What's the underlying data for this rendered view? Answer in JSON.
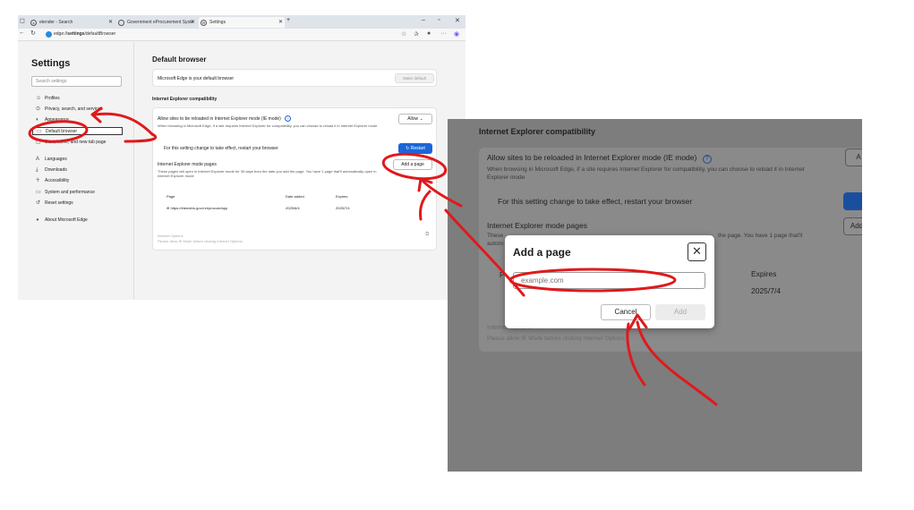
{
  "browser": {
    "tabs": [
      {
        "label": "etender - Search"
      },
      {
        "label": "Government eProcurement Syste"
      },
      {
        "label": "Settings"
      }
    ],
    "window_controls": [
      "–",
      "▫",
      "✕"
    ],
    "address": {
      "prefix": "edge://",
      "bold": "settings",
      "suffix": "/defaultBrowser"
    }
  },
  "settings": {
    "title": "Settings",
    "search_placeholder": "Search settings",
    "nav": [
      {
        "label": "Profiles",
        "icon": "profile-icon"
      },
      {
        "label": "Privacy, search, and services",
        "icon": "lock-icon"
      },
      {
        "label": "Appearance",
        "icon": "appearance-icon"
      },
      {
        "label": "Default browser",
        "icon": "browser-icon"
      },
      {
        "label": "Start, home, and new tab page",
        "icon": "home-icon"
      },
      {
        "label": "Languages",
        "icon": "language-icon"
      },
      {
        "label": "Downloads",
        "icon": "download-icon"
      },
      {
        "label": "Accessibility",
        "icon": "accessibility-icon"
      },
      {
        "label": "System and performance",
        "icon": "system-icon"
      },
      {
        "label": "Reset settings",
        "icon": "reset-icon"
      },
      {
        "label": "About Microsoft Edge",
        "icon": "edge-icon"
      }
    ],
    "selected_index": 3
  },
  "main": {
    "heading": "Default browser",
    "default_status": "Microsoft Edge is your default browser",
    "make_default_label": "Make default",
    "ie_heading": "Internet Explorer compatibility",
    "ie_mode_label": "Allow sites to be reloaded in Internet Explorer mode (IE mode)",
    "ie_mode_desc": "When browsing in Microsoft Edge, if a site requires Internet Explorer for compatibility, you can choose to reload it in Internet Explorer mode",
    "allow_label": "Allow",
    "restart_text": "For this setting change to take effect, restart your browser",
    "restart_label": "Restart",
    "pages_heading": "Internet Explorer mode pages",
    "pages_desc": "These pages will open in Internet Explorer mode for 30 days from the date you add the page. You have 1 page that'll automatically open in Internet Explorer mode",
    "add_page_label": "Add a page",
    "table": {
      "headers": [
        "Page",
        "Date added",
        "Expires"
      ],
      "rows": [
        {
          "page": "https://etenders.gov.in/eprocure/app",
          "date_added": "2025/6/4",
          "expires": "2025/7/4"
        }
      ]
    },
    "internet_options_label": "Internet Options",
    "internet_options_desc": "Please allow IE Mode before clicking Internet Options"
  },
  "zoom": {
    "heading": "Internet Explorer compatibility",
    "ie_mode_label": "Allow sites to be reloaded in Internet Explorer mode (IE mode)",
    "ie_mode_desc_1": "When browsing in Microsoft Edge, if a site requires Internet Explorer for compatibility, you can choose to reload it in Internet",
    "ie_mode_desc_2": "Explorer mode",
    "restart_text": "For this setting change to take effect, restart your browser",
    "pages_heading": "Internet Explorer mode pages",
    "pages_desc_left": "These",
    "pages_desc_right": "the page. You have 1 page that'll",
    "pages_desc_left2": "autom",
    "btn_a": "A",
    "btn_add": "Add",
    "col_expires": "Expires",
    "expires_value": "2025/7/4",
    "col_p": "P",
    "internet_options": "Internet Options",
    "internet_options_desc": "Please allow IE Mode before clicking Internet Options"
  },
  "dialog": {
    "title": "Add a page",
    "input_placeholder": "example.com",
    "cancel_label": "Cancel",
    "add_label": "Add"
  },
  "colors": {
    "annotation_red": "#e0191b",
    "accent_blue": "#1a66d8"
  }
}
